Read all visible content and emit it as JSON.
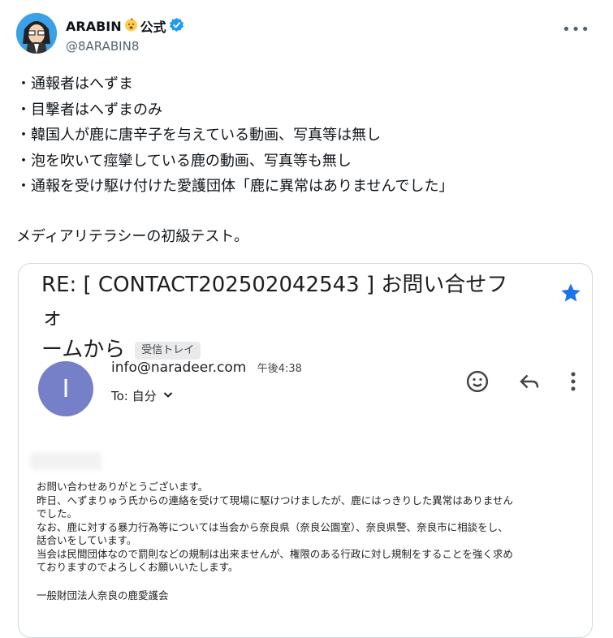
{
  "post": {
    "display_name": "ARABIN",
    "display_suffix": "公式",
    "handle": "@8ARABIN8",
    "more_label": "•••",
    "lines": [
      "・通報者はへずま",
      "・目撃者はへずまのみ",
      "・韓国人が鹿に唐辛子を与えている動画、写真等は無し",
      "・泡を吹いて痙攣している鹿の動画、写真等も無し",
      "・通報を受け駆け付けた愛護団体「鹿に異常はありませんでした」"
    ],
    "closing": "メディアリテラシーの初級テスト。"
  },
  "email": {
    "subject": "RE: [ CONTACT202502042543 ] お問い合せフォームから",
    "subject_line1": "RE: [ CONTACT202502042543 ] お問い合せフォ",
    "subject_line2": "ームから",
    "label": "受信トレイ",
    "sender_initial": "I",
    "sender": "info@naradeer.com",
    "time": "午後4:38",
    "recipient": "To: 自分",
    "body_lines": [
      "お問い合わせありがとうございます。",
      "昨日、へずまりゅう氏からの連絡を受けて現場に駆けつけましたが、鹿にはっきりした異常はありません",
      "でした。",
      "なお、鹿に対する暴力行為等については当会から奈良県（奈良公園室）、奈良県警、奈良市に相談をし、",
      "話合いをしています。",
      "当会は民間団体なので罰則などの規制は出来ませんが、権限のある行政に対し規制をすることを強く求め",
      "ておりますのでよろしくお願いいたします。"
    ],
    "signature": "一般財団法人奈良の鹿愛護会"
  },
  "icons": {
    "verified": "verified-badge-icon",
    "emoji": "baby-face-emoji-icon",
    "star": "star-icon",
    "smiley": "emoji-react-icon",
    "reply": "reply-icon",
    "more": "more-vert-icon",
    "chevron": "chevron-down-icon"
  },
  "colors": {
    "verified": "#1d9bf0",
    "star": "#1a73e8",
    "sender_avatar": "#7580c8"
  }
}
